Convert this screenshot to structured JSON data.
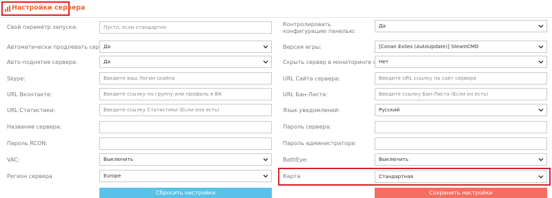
{
  "header": {
    "title": "Настройки сервера"
  },
  "left": [
    {
      "label": "Свой параметр запуска:",
      "type": "input",
      "value": "Пусто, если стандартно"
    },
    {
      "label": "Автоматически продлевать сервер:",
      "type": "select",
      "value": "Да"
    },
    {
      "label": "Авто-поднятие сервера:",
      "type": "select",
      "value": "Да"
    },
    {
      "label": "Skype:",
      "type": "input",
      "value": "Введите ваш Логин скайпа"
    },
    {
      "label": "URL Вконтакте:",
      "type": "input",
      "value": "Введите ссылку на группу или профиль в ВК"
    },
    {
      "label": "URL Статистики:",
      "type": "input",
      "value": "Введите ссылку Статистики (Если она есть)"
    },
    {
      "label": "Название сервера:",
      "type": "input",
      "value": ""
    },
    {
      "label": "Пароль RCON:",
      "type": "input",
      "value": ""
    },
    {
      "label": "VAC:",
      "type": "select",
      "value": "Выключить"
    },
    {
      "label": "Регион сервера",
      "type": "select",
      "value": "Europe"
    }
  ],
  "right": [
    {
      "label": "Контролировать конфигурацию панелью:",
      "type": "select",
      "value": "Да"
    },
    {
      "label": "Версия игры:",
      "type": "select",
      "value": "[Conan Exiles (AutoUpdate)] SteamCMD"
    },
    {
      "label": "Скрыть сервер в мониторинге сайта:",
      "type": "select",
      "value": "Нет"
    },
    {
      "label": "URL Сайта сервера:",
      "type": "input",
      "value": "Введите URL ссылку на сайт сервера"
    },
    {
      "label": "URL Бан-Листа:",
      "type": "input",
      "value": "Введите ссылку Бан-Листа (Если он есть)"
    },
    {
      "label": "Язык уведомлений:",
      "type": "select",
      "value": "Русский"
    },
    {
      "label": "Пароль сервера:",
      "type": "input",
      "value": ""
    },
    {
      "label": "Пароль администратора:",
      "type": "input",
      "value": ""
    },
    {
      "label": "BattlEye:",
      "type": "select",
      "value": "Выключить"
    },
    {
      "label": "Карта",
      "type": "select",
      "value": "Стандартная"
    }
  ],
  "buttons": {
    "reset": "Сбросить настройки",
    "save": "Сохранить настройки"
  },
  "colors": {
    "title": "#f0642c",
    "highlight": "#d81f26",
    "reset": "#5ac1e8",
    "save": "#f26f61"
  },
  "icons": {
    "title": "bar-chart-icon",
    "select": "chevron-down-icon"
  }
}
